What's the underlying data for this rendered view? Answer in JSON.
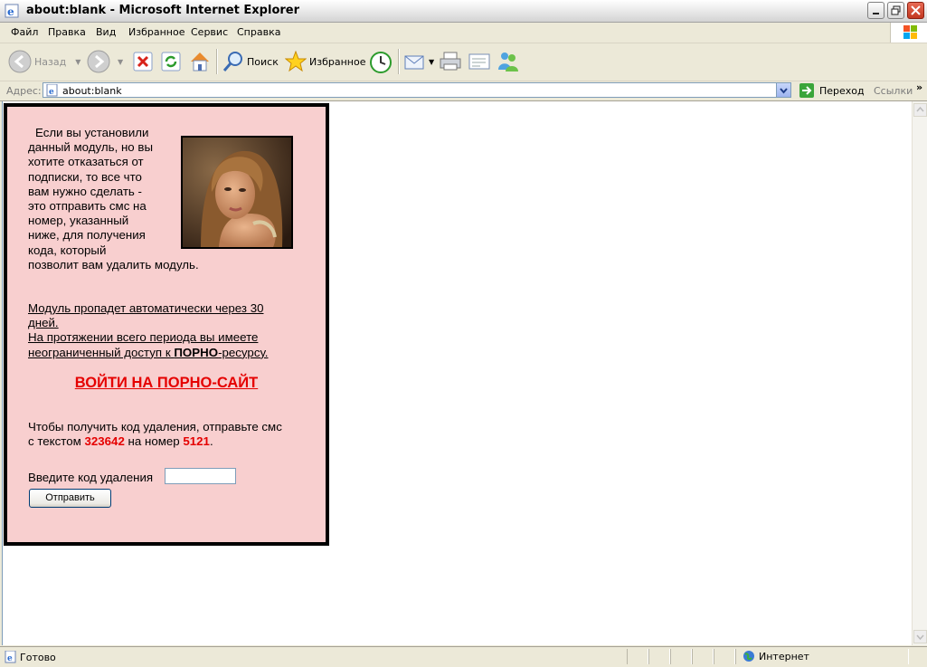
{
  "window": {
    "title": "about:blank - Microsoft Internet Explorer"
  },
  "menu": [
    "Файл",
    "Правка",
    "Вид",
    "Избранное",
    "Сервис",
    "Справка"
  ],
  "toolbar": {
    "back": "Назад",
    "search": "Поиск",
    "favorites": "Избранное"
  },
  "address": {
    "label": "Адрес:",
    "value": "about:blank",
    "go": "Переход",
    "links": "Ссылки",
    "more": "»"
  },
  "page": {
    "intro_lines": [
      "Если вы установили",
      "данный модуль, но вы",
      "хотите отказаться от",
      "подписки, то все что",
      "вам нужно сделать -",
      "это отправить смс на",
      "номер, указанный",
      "ниже, для получения",
      "кода, который",
      "позволит вам удалить модуль."
    ],
    "notice_line1": "Модуль пропадет автоматически через 30",
    "notice_line2": "дней.",
    "notice_line3": "На протяжении всего периода вы имеете",
    "notice_line4_pre": "неограниченный доступ к ",
    "notice_line4_bold": "ПОРНО",
    "notice_line4_post": "-ресурсу.",
    "enter_link": "ВОЙТИ НА ПОРНО-САЙТ",
    "sms_line1": "Чтобы получить код удаления, отправьте смс",
    "sms_pre": "с текстом ",
    "sms_code": "323642",
    "sms_mid": " на номер ",
    "sms_number": "5121",
    "sms_end": ".",
    "code_label": "Введите код удаления",
    "code_value": "",
    "submit": "Отправить"
  },
  "status": {
    "text": "Готово",
    "zone": "Интернет"
  },
  "colors": {
    "panel_bg": "#f8cfcf",
    "accent_red": "#e50000"
  }
}
